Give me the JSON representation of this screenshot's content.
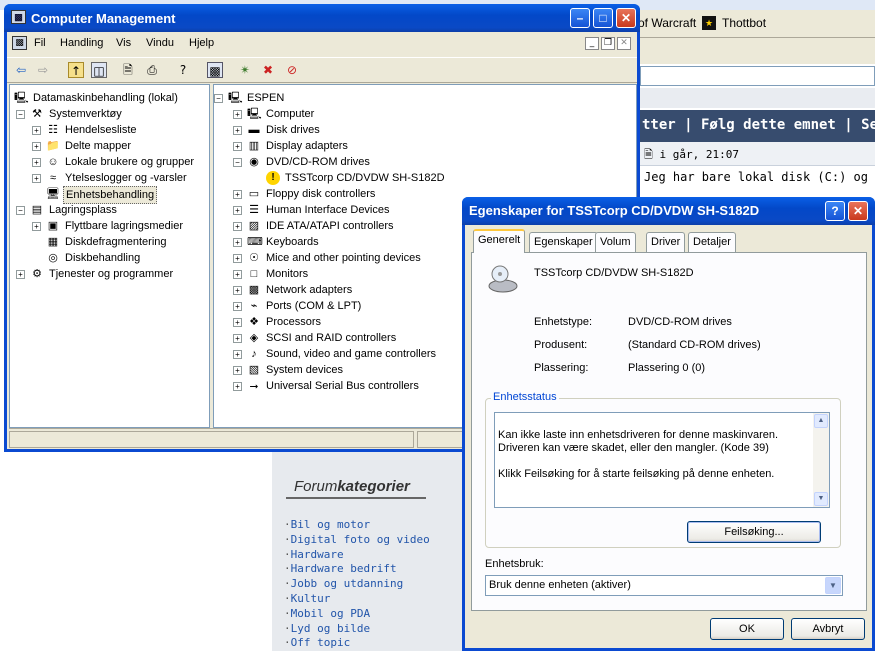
{
  "background": {
    "tab1": "of Warcraft",
    "tab2": "Thottbot",
    "thread_header": "tter | Følg dette emnet | Send d",
    "post_meta": "i går, 21:07",
    "post_text": "Jeg har bare lokal disk (C:) og Delte",
    "forum_title_a": "Forum",
    "forum_title_b": "kategorier",
    "forum_links": [
      "Bil og motor",
      "Digital foto og video",
      "Hardware",
      "Hardware bedrift",
      "Jobb og utdanning",
      "Kultur",
      "Mobil og PDA",
      "Lyd og bilde",
      "Off topic"
    ]
  },
  "cm": {
    "title": "Computer Management",
    "menu": [
      "Fil",
      "Handling",
      "Vis",
      "Vindu",
      "Hjelp"
    ],
    "left_tree": [
      {
        "label": "Datamaskinbehandling (lokal)",
        "icon": "computer-icon",
        "level": 0,
        "expander": "none"
      },
      {
        "label": "Systemverktøy",
        "icon": "tools-icon",
        "level": 1,
        "expander": "minus"
      },
      {
        "label": "Hendelseslistе",
        "icon": "event-viewer-icon",
        "level": 2,
        "expander": "plus"
      },
      {
        "label": "Delte mapper",
        "icon": "shared-folder-icon",
        "level": 2,
        "expander": "plus"
      },
      {
        "label": "Lokale brukere og grupper",
        "icon": "users-icon",
        "level": 2,
        "expander": "plus"
      },
      {
        "label": "Ytelseslogger og -varsler",
        "icon": "performance-icon",
        "level": 2,
        "expander": "plus"
      },
      {
        "label": "Enhetsbehandling",
        "icon": "device-manager-icon",
        "level": 2,
        "expander": "none",
        "selected": true
      },
      {
        "label": "Lagringsplass",
        "icon": "storage-icon",
        "level": 1,
        "expander": "minus"
      },
      {
        "label": "Flyttbare lagringsmedier",
        "icon": "removable-storage-icon",
        "level": 2,
        "expander": "plus"
      },
      {
        "label": "Diskdefragmentering",
        "icon": "defrag-icon",
        "level": 2,
        "expander": "none"
      },
      {
        "label": "Diskbehandling",
        "icon": "disk-management-icon",
        "level": 2,
        "expander": "none"
      },
      {
        "label": "Tjenester og programmer",
        "icon": "services-icon",
        "level": 1,
        "expander": "plus"
      }
    ],
    "right_tree": [
      {
        "label": "ESPEN",
        "icon": "computer-icon",
        "level": 0,
        "expander": "minus"
      },
      {
        "label": "Computer",
        "icon": "computer-icon",
        "level": 1,
        "expander": "plus"
      },
      {
        "label": "Disk drives",
        "icon": "disk-drive-icon",
        "level": 1,
        "expander": "plus"
      },
      {
        "label": "Display adapters",
        "icon": "display-adapter-icon",
        "level": 1,
        "expander": "plus"
      },
      {
        "label": "DVD/CD-ROM drives",
        "icon": "cdrom-icon",
        "level": 1,
        "expander": "minus"
      },
      {
        "label": "TSSTcorp CD/DVDW SH-S182D",
        "icon": "warning-cdrom-icon",
        "level": 2,
        "expander": "none"
      },
      {
        "label": "Floppy disk controllers",
        "icon": "floppy-icon",
        "level": 1,
        "expander": "plus"
      },
      {
        "label": "Human Interface Devices",
        "icon": "hid-icon",
        "level": 1,
        "expander": "plus"
      },
      {
        "label": "IDE ATA/ATAPI controllers",
        "icon": "ide-icon",
        "level": 1,
        "expander": "plus"
      },
      {
        "label": "Keyboards",
        "icon": "keyboard-icon",
        "level": 1,
        "expander": "plus"
      },
      {
        "label": "Mice and other pointing devices",
        "icon": "mouse-icon",
        "level": 1,
        "expander": "plus"
      },
      {
        "label": "Monitors",
        "icon": "monitor-icon",
        "level": 1,
        "expander": "plus"
      },
      {
        "label": "Network adapters",
        "icon": "network-icon",
        "level": 1,
        "expander": "plus"
      },
      {
        "label": "Ports (COM & LPT)",
        "icon": "port-icon",
        "level": 1,
        "expander": "plus"
      },
      {
        "label": "Processors",
        "icon": "processor-icon",
        "level": 1,
        "expander": "plus"
      },
      {
        "label": "SCSI and RAID controllers",
        "icon": "scsi-icon",
        "level": 1,
        "expander": "plus"
      },
      {
        "label": "Sound, video and game controllers",
        "icon": "sound-icon",
        "level": 1,
        "expander": "plus"
      },
      {
        "label": "System devices",
        "icon": "system-device-icon",
        "level": 1,
        "expander": "plus"
      },
      {
        "label": "Universal Serial Bus controllers",
        "icon": "usb-icon",
        "level": 1,
        "expander": "plus"
      }
    ]
  },
  "dlg": {
    "title": "Egenskaper for TSSTcorp CD/DVDW SH-S182D",
    "tabs": [
      "Generelt",
      "Egenskaper",
      "Volum",
      "Driver",
      "Detaljer"
    ],
    "device_name": "TSSTcorp CD/DVDW SH-S182D",
    "type_label": "Enhetstype:",
    "type_value": "DVD/CD-ROM drives",
    "maker_label": "Produsent:",
    "maker_value": "(Standard CD-ROM drives)",
    "location_label": "Plassering:",
    "location_value": "Plassering 0 (0)",
    "status_group": "Enhetsstatus",
    "status_text": "Kan ikke laste inn enhetsdriveren for denne maskinvaren. Driveren kan være skadet, eller den mangler. (Kode 39)\n\nKlikk Feilsøking for å starte feilsøking på denne enheten.",
    "troubleshoot": "Feilsøking...",
    "usage_label": "Enhetsbruk:",
    "usage_value": "Bruk denne enheten (aktiver)",
    "ok": "OK",
    "cancel": "Avbryt"
  }
}
